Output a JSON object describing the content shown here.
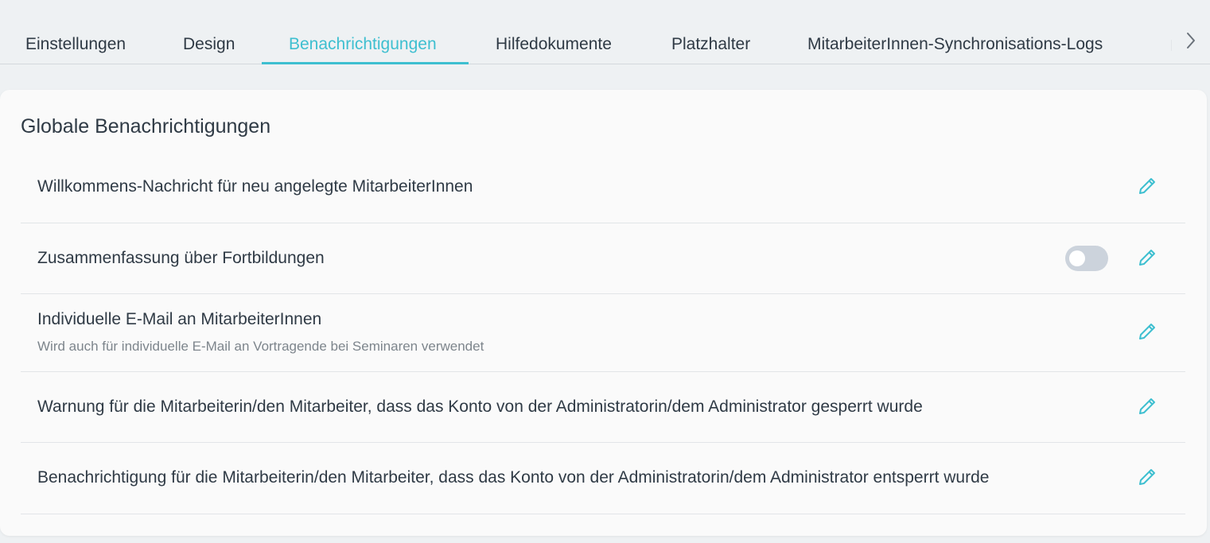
{
  "tabs": [
    {
      "label": "Einstellungen",
      "active": false
    },
    {
      "label": "Design",
      "active": false
    },
    {
      "label": "Benachrichtigungen",
      "active": true
    },
    {
      "label": "Hilfedokumente",
      "active": false
    },
    {
      "label": "Platzhalter",
      "active": false
    },
    {
      "label": "MitarbeiterInnen-Synchronisations-Logs",
      "active": false
    }
  ],
  "tab_next_icon": "chevron-right-icon",
  "section": {
    "title": "Globale Benachrichtigungen",
    "rows": [
      {
        "label": "Willkommens-Nachricht für neu angelegte MitarbeiterInnen",
        "subtitle": "",
        "toggle": null
      },
      {
        "label": "Zusammenfassung über Fortbildungen",
        "subtitle": "",
        "toggle": false
      },
      {
        "label": "Individuelle E-Mail an MitarbeiterInnen",
        "subtitle": "Wird auch für individuelle E-Mail an Vortragende bei Seminaren verwendet",
        "toggle": null
      },
      {
        "label": "Warnung für die Mitarbeiterin/den Mitarbeiter, dass das Konto von der Administratorin/dem Administrator gesperrt wurde",
        "subtitle": "",
        "toggle": null
      },
      {
        "label": "Benachrichtigung für die Mitarbeiterin/den Mitarbeiter, dass das Konto von der Administratorin/dem Administrator entsperrt wurde",
        "subtitle": "",
        "toggle": null
      }
    ]
  },
  "icons": {
    "edit": "pencil-icon"
  },
  "colors": {
    "accent": "#3ebfd0",
    "text": "#2f3a45",
    "muted": "#7d858c",
    "toggle_off": "#ccd3dc",
    "background": "#eef1f3",
    "card": "#fafafa"
  }
}
